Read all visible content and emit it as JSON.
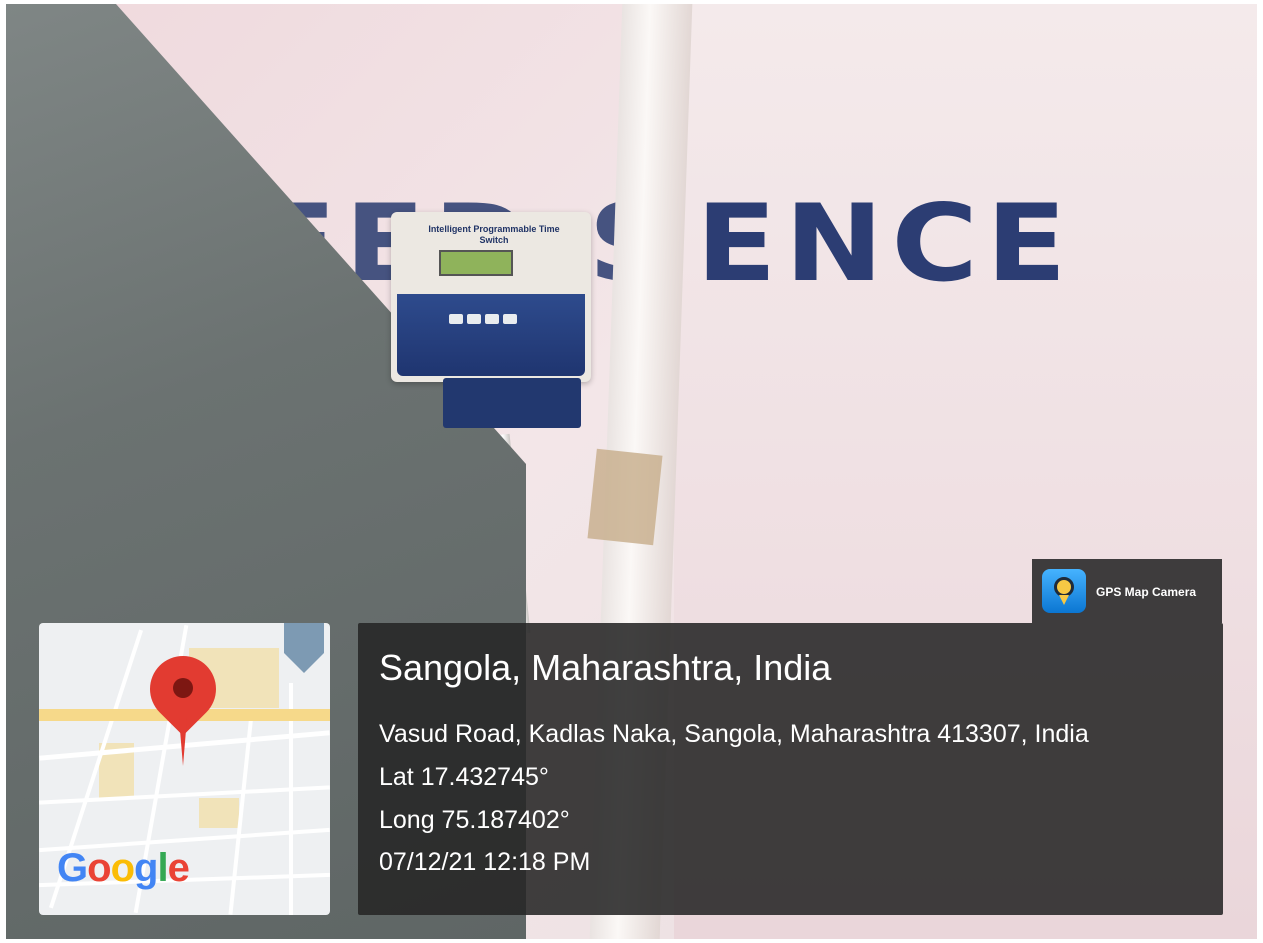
{
  "photo": {
    "wall_text_left": "EED S",
    "wall_text_right": "ENCE",
    "device_label": "Intelligent Programmable Time Switch"
  },
  "badge": {
    "label": "GPS Map Camera",
    "icon": "gps-map-camera-icon"
  },
  "map": {
    "logo_text": "Google",
    "pin_icon": "map-pin-icon",
    "poi_icon": "map-poi-icon"
  },
  "info": {
    "title": "Sangola, Maharashtra, India",
    "address": "Vasud Road, Kadlas Naka, Sangola, Maharashtra 413307, India",
    "lat": "Lat 17.432745°",
    "long": "Long 75.187402°",
    "datetime": "07/12/21 12:18 PM"
  },
  "colors": {
    "overlay_bg": "#262626",
    "wall_letters": "#2c3d73",
    "pin": "#e23b31"
  }
}
